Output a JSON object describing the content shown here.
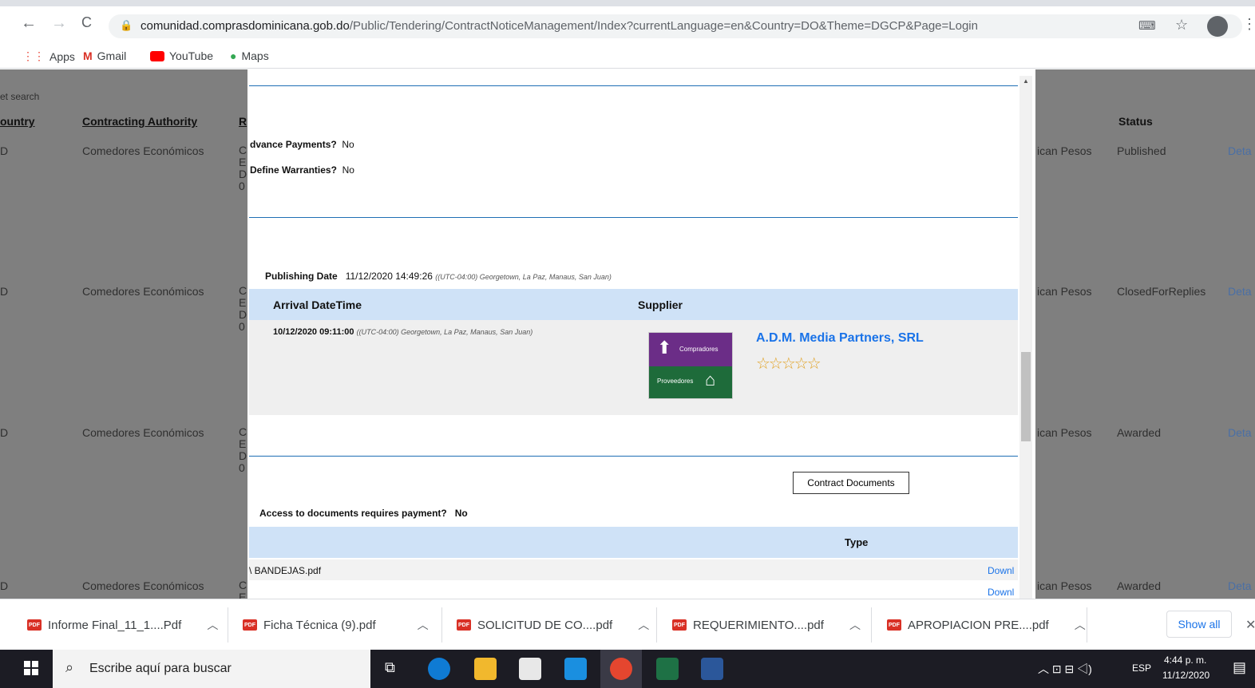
{
  "browser": {
    "url_domain": "comunidad.comprasdominicana.gob.do",
    "url_path": "/Public/Tendering/ContractNoticeManagement/Index?currentLanguage=en&Country=DO&Theme=DGCP&Page=Login",
    "bookmarks": [
      "Apps",
      "Gmail",
      "YouTube",
      "Maps"
    ]
  },
  "background": {
    "reset_search": "et search",
    "headers": {
      "country": "ountry",
      "authority": "Contracting Authority",
      "r": "R",
      "status": "Status"
    },
    "rows": [
      {
        "country": "D",
        "authority": "Comedores Económicos",
        "currency": "ican Pesos",
        "status": "Published",
        "details": "Deta"
      },
      {
        "country": "D",
        "authority": "Comedores Económicos",
        "currency": "ican Pesos",
        "status": "ClosedForReplies",
        "details": "Deta"
      },
      {
        "country": "D",
        "authority": "Comedores Económicos",
        "currency": "ican Pesos",
        "status": "Awarded",
        "details": "Deta"
      },
      {
        "country": "D",
        "authority": "Comedores Económicos",
        "currency": "ican Pesos",
        "status": "Awarded",
        "details": "Deta"
      }
    ],
    "col_letters": [
      "C",
      "E",
      "D",
      "0"
    ]
  },
  "modal": {
    "advance_label": "dvance Payments?",
    "advance_value": "No",
    "warranties_label": "Define Warranties?",
    "warranties_value": "No",
    "publishing_label": "Publishing Date",
    "publishing_value": "11/12/2020 14:49:26",
    "tz": "((UTC-04:00) Georgetown, La Paz, Manaus, San Juan)",
    "col_arrival": "Arrival DateTime",
    "col_supplier": "Supplier",
    "arrival_value": "10/12/2020 09:11:00",
    "supplier_name": "A.D.M. Media Partners, SRL",
    "logo_top": "Compradores",
    "logo_bottom": "Proveedores",
    "rating": "☆☆☆☆☆",
    "contract_docs_btn": "Contract Documents",
    "access_label": "Access to documents requires payment?",
    "access_value": "No",
    "type_header": "Type",
    "doc1_name": "\\ BANDEJAS.pdf",
    "download": "Downl"
  },
  "downloads": [
    {
      "name": "Informe Final_11_1....Pdf"
    },
    {
      "name": "Ficha Técnica (9).pdf"
    },
    {
      "name": "SOLICITUD DE CO....pdf"
    },
    {
      "name": "REQUERIMIENTO....pdf"
    },
    {
      "name": "APROPIACION PRE....pdf"
    }
  ],
  "show_all": "Show all",
  "taskbar": {
    "search_placeholder": "Escribe aquí para buscar",
    "lang": "ESP",
    "time": "4:44 p. m.",
    "date": "11/12/2020"
  }
}
